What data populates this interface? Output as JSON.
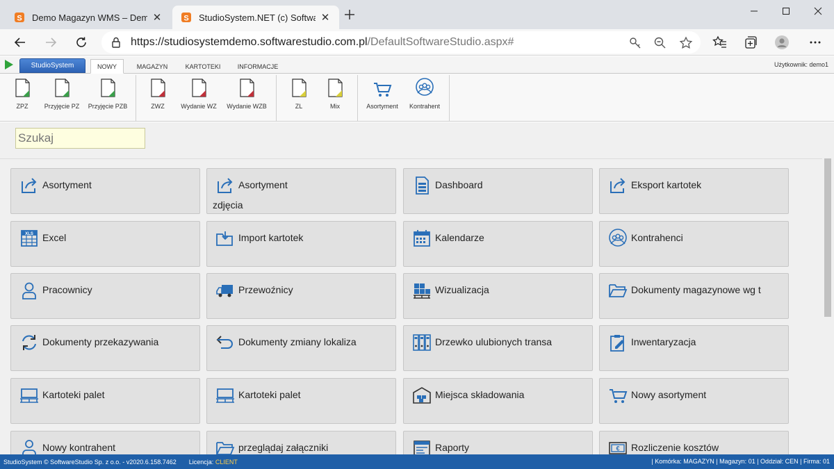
{
  "browser": {
    "tabs": [
      {
        "title": "Demo Magazyn WMS – Demo or",
        "active": false
      },
      {
        "title": "StudioSystem.NET (c) SoftwareSt",
        "active": true
      }
    ],
    "close_glyph": "✕",
    "url_host": "https://studiosystemdemo.softwarestudio.com.pl",
    "url_path": "/DefaultSoftwareStudio.aspx#",
    "icons": [
      "back-icon",
      "forward-icon",
      "refresh-icon",
      "lock-icon",
      "key-icon",
      "zoom-out-icon",
      "star-icon",
      "favorites-icon",
      "collections-icon",
      "profile-icon",
      "more-icon"
    ]
  },
  "app": {
    "brand_button": "StudioSystem",
    "menu_tabs": [
      "NOWY",
      "MAGAZYN",
      "KARTOTEKI",
      "INFORMACJE"
    ],
    "active_tab": "NOWY",
    "user_label": "Użytkownik: demo1",
    "ribbon": [
      {
        "label": "ZPZ",
        "icon": "document-green-icon"
      },
      {
        "label": "Przyjęcie PZ",
        "icon": "document-green-icon"
      },
      {
        "label": "Przyjęcie PZB",
        "icon": "document-green-icon"
      },
      {
        "label": "ZWZ",
        "icon": "document-red-icon"
      },
      {
        "label": "Wydanie WZ",
        "icon": "document-red-icon"
      },
      {
        "label": "Wydanie WZB",
        "icon": "document-red-icon"
      },
      {
        "label": "ZL",
        "icon": "document-yellow-icon"
      },
      {
        "label": "Mix",
        "icon": "document-yellow-icon"
      },
      {
        "label": "Asortyment",
        "icon": "cart-icon"
      },
      {
        "label": "Kontrahent",
        "icon": "people-icon"
      }
    ],
    "search_placeholder": "Szukaj",
    "tiles": [
      {
        "label": "Asortyment",
        "sub": "",
        "icon": "share-arrow-icon"
      },
      {
        "label": "Asortyment",
        "sub": "zdjęcia",
        "icon": "share-arrow-icon"
      },
      {
        "label": "Dashboard",
        "sub": "",
        "icon": "dashboard-icon"
      },
      {
        "label": "Eksport kartotek",
        "sub": "",
        "icon": "share-arrow-icon"
      },
      {
        "label": "Excel",
        "sub": "",
        "icon": "excel-icon"
      },
      {
        "label": "Import kartotek",
        "sub": "",
        "icon": "import-folder-icon"
      },
      {
        "label": "Kalendarze",
        "sub": "",
        "icon": "calendar-icon"
      },
      {
        "label": "Kontrahenci",
        "sub": "",
        "icon": "people-icon"
      },
      {
        "label": "Pracownicy",
        "sub": "",
        "icon": "person-icon"
      },
      {
        "label": "Przewoźnicy",
        "sub": "",
        "icon": "truck-icon"
      },
      {
        "label": "Wizualizacja",
        "sub": "",
        "icon": "pallet-boxes-icon"
      },
      {
        "label": "Dokumenty magazynowe wg t",
        "sub": "",
        "icon": "folder-open-icon"
      },
      {
        "label": "Dokumenty przekazywania",
        "sub": "",
        "icon": "sync-icon"
      },
      {
        "label": "Dokumenty zmiany lokaliza",
        "sub": "",
        "icon": "return-arrow-icon"
      },
      {
        "label": "Drzewko ulubionych transa",
        "sub": "",
        "icon": "binders-icon"
      },
      {
        "label": "Inwentaryzacja",
        "sub": "",
        "icon": "clipboard-pen-icon"
      },
      {
        "label": "Kartoteki palet",
        "sub": "",
        "icon": "pallet-icon"
      },
      {
        "label": "Kartoteki palet",
        "sub": "",
        "icon": "pallet-icon"
      },
      {
        "label": "Miejsca składowania",
        "sub": "",
        "icon": "warehouse-icon"
      },
      {
        "label": "Nowy asortyment",
        "sub": "",
        "icon": "cart-icon"
      },
      {
        "label": "Nowy kontrahent",
        "sub": "",
        "icon": "person-add-icon"
      },
      {
        "label": "przeglądaj załączniki",
        "sub": "",
        "icon": "folder-open-icon"
      },
      {
        "label": "Raporty",
        "sub": "",
        "icon": "report-icon"
      },
      {
        "label": "Rozliczenie kosztów",
        "sub": "",
        "icon": "money-icon"
      }
    ]
  },
  "status": {
    "left": "StudioSystem © SoftwareStudio Sp. z o.o. - v2020.6.158.7462",
    "license_label": "Licencja:",
    "license_value": "CLIENT",
    "komorka_label": "| Komórka:",
    "komorka_value": "MAGAZYN",
    "magazyn_label": "| Magazyn:",
    "magazyn_value": "01",
    "oddzial_label": "| Oddział:",
    "oddzial_value": "CEN",
    "firma_label": "| Firma:",
    "firma_value": "01"
  },
  "colors": {
    "accent_blue": "#1f5fa8",
    "icon_blue": "#2a6fb8",
    "doc_green": "#3aa04a",
    "doc_red": "#c0303a",
    "doc_yellow": "#d9cf3a",
    "license_highlight": "#ffcf4a"
  }
}
